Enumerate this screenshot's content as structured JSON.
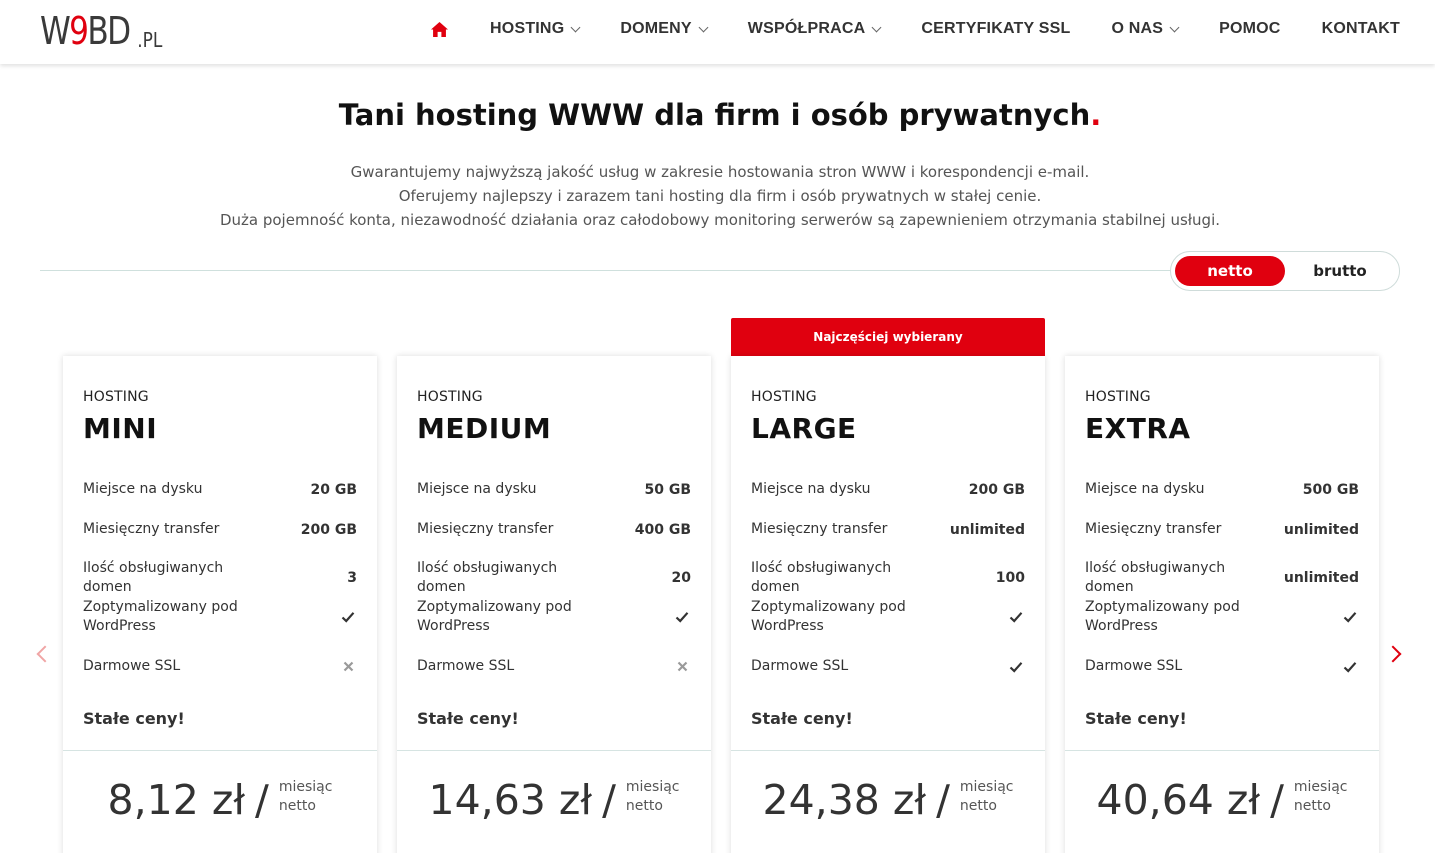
{
  "logo": {
    "main_a": "W",
    "main_b": "9",
    "main_c": "BD",
    "suffix": ".PL"
  },
  "nav": {
    "items": [
      {
        "label": "HOSTING",
        "has_dropdown": true
      },
      {
        "label": "DOMENY",
        "has_dropdown": true
      },
      {
        "label": "WSPÓŁPRACA",
        "has_dropdown": true
      },
      {
        "label": "CERTYFIKATY SSL",
        "has_dropdown": false
      },
      {
        "label": "O NAS",
        "has_dropdown": true
      },
      {
        "label": "POMOC",
        "has_dropdown": false
      },
      {
        "label": "KONTAKT",
        "has_dropdown": false
      }
    ]
  },
  "hero": {
    "title": "Tani hosting WWW dla firm i osób prywatnych",
    "title_dot": ".",
    "lines": [
      "Gwarantujemy najwyższą jakość usług w zakresie hostowania stron WWW i korespondencji e-mail.",
      "Oferujemy najlepszy i zarazem tani hosting dla firm i osób prywatnych w stałej cenie.",
      "Duża pojemność konta, niezawodność działania oraz całodobowy monitoring serwerów są zapewnieniem otrzymania stabilnej usługi."
    ]
  },
  "price_toggle": {
    "netto": "netto",
    "brutto": "brutto",
    "selected": "netto"
  },
  "badge": "Najczęściej wybierany",
  "spec_labels": {
    "disk": "Miejsce na dysku",
    "transfer": "Miesięczny transfer",
    "domains": "Ilość obsługiwanych domen",
    "wordpress": "Zoptymalizowany pod WordPress",
    "ssl": "Darmowe SSL"
  },
  "stale_ceny": "Stałe ceny!",
  "period": {
    "line1": "miesiąc",
    "line2": "netto"
  },
  "plans": [
    {
      "kicker": "HOSTING",
      "name": "MINI",
      "disk": "20 GB",
      "transfer": "200 GB",
      "domains": "3",
      "wordpress": true,
      "ssl": false,
      "price": "8,12 zł"
    },
    {
      "kicker": "HOSTING",
      "name": "MEDIUM",
      "disk": "50 GB",
      "transfer": "400 GB",
      "domains": "20",
      "wordpress": true,
      "ssl": false,
      "price": "14,63 zł"
    },
    {
      "kicker": "HOSTING",
      "name": "LARGE",
      "disk": "200 GB",
      "transfer": "unlimited",
      "domains": "100",
      "wordpress": true,
      "ssl": true,
      "price": "24,38 zł"
    },
    {
      "kicker": "HOSTING",
      "name": "EXTRA",
      "disk": "500 GB",
      "transfer": "unlimited",
      "domains": "unlimited",
      "wordpress": true,
      "ssl": true,
      "price": "40,64 zł"
    }
  ],
  "colors": {
    "accent": "#e0000f",
    "text": "#333333"
  },
  "icons": {
    "home": "home-icon",
    "prev": "chevron-left-icon",
    "next": "chevron-right-icon",
    "check": "check-icon",
    "cross": "cross-icon"
  }
}
